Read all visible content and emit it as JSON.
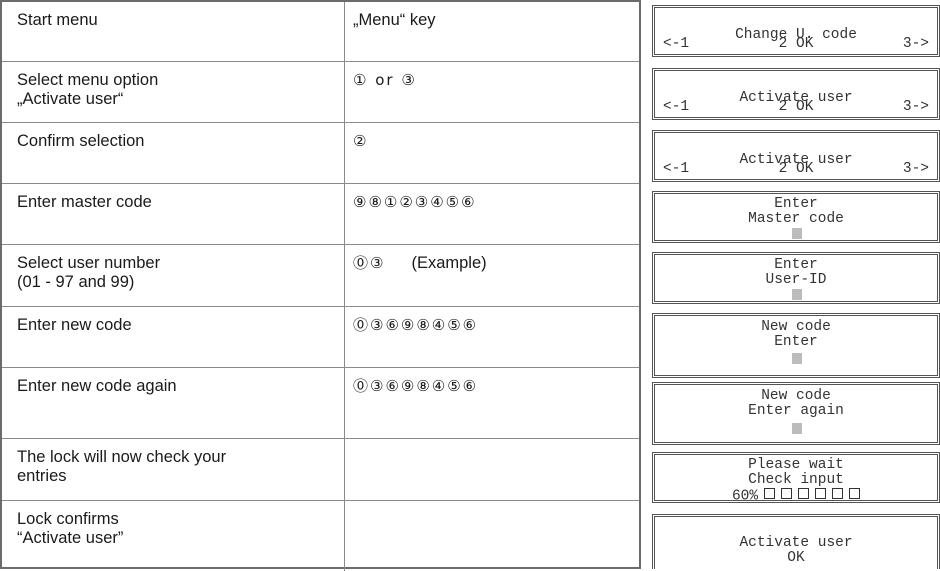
{
  "rows": [
    {
      "step": "Start menu",
      "action": "„Menu“ key"
    },
    {
      "step": "Select menu option",
      "step2": "„Activate user“",
      "keys": "① or ③"
    },
    {
      "step": "Confirm selection",
      "keys": "②"
    },
    {
      "step": "Enter master code",
      "keys": "⑨⑧①②③④⑤⑥"
    },
    {
      "step": "Select user number",
      "step2": "(01 - 97 and 99)",
      "keys": "⓪③",
      "note": "(Example)"
    },
    {
      "step": "Enter new code",
      "keys": "⓪③⑥⑨⑧④⑤⑥"
    },
    {
      "step": "Enter new code again",
      "keys": "⓪③⑥⑨⑧④⑤⑥"
    },
    {
      "step": "The lock will now check your",
      "step2": "entries"
    },
    {
      "step": "Lock confirms",
      "step2": "“Activate user”"
    }
  ],
  "displays": [
    {
      "line1": "Change U. code",
      "nav_left": "<-1",
      "nav_mid": "2 OK",
      "nav_right": "3->"
    },
    {
      "line1": "Activate user",
      "nav_left": "<-1",
      "nav_mid": "2 OK",
      "nav_right": "3->"
    },
    {
      "line1": "Activate user",
      "nav_left": "<-1",
      "nav_mid": "2 OK",
      "nav_right": "3->"
    },
    {
      "line1": "Enter",
      "line2": "Master code"
    },
    {
      "line1": "Enter",
      "line2": "User-ID"
    },
    {
      "line1": "New code",
      "line2": "Enter"
    },
    {
      "line1": "New code",
      "line2": "Enter again"
    },
    {
      "line1": "Please wait",
      "line2": "Check input",
      "progress": "60%"
    },
    {
      "line1": "Activate user",
      "line2": "OK"
    }
  ]
}
